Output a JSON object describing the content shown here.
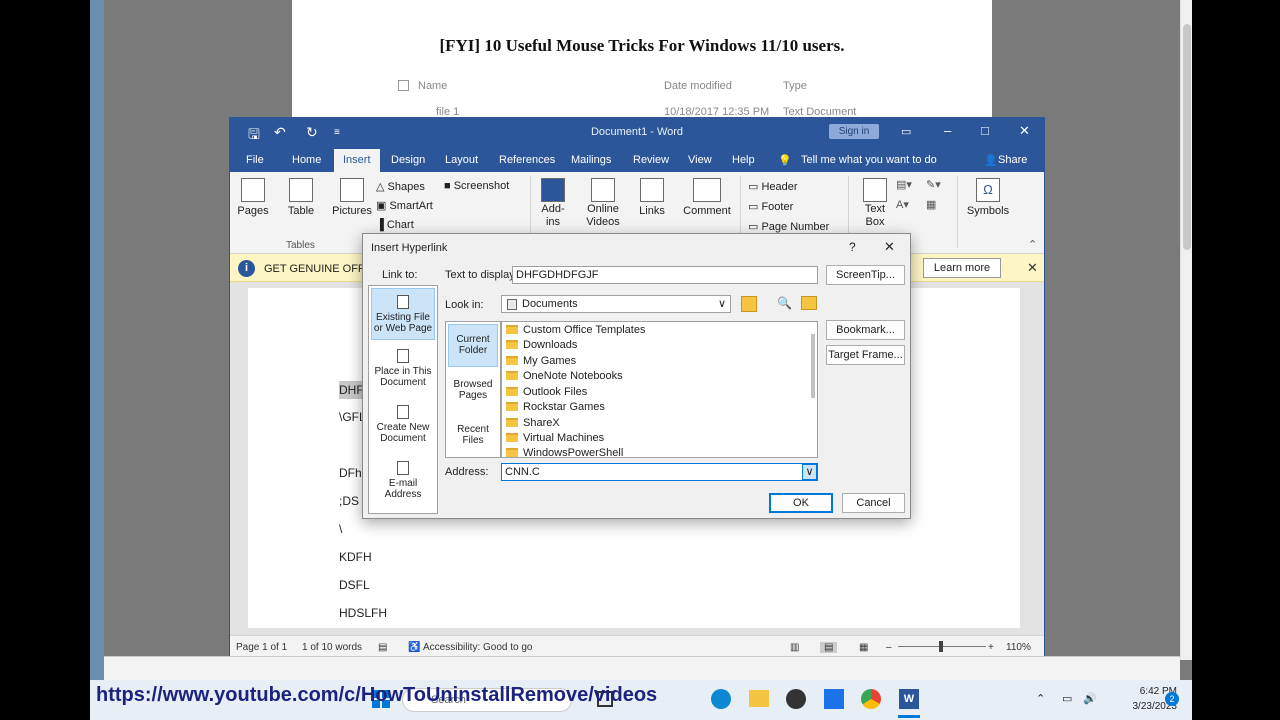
{
  "background_doc": {
    "title": "[FYI] 10 Useful Mouse Tricks For Windows 11/10 users.",
    "columns": [
      "Name",
      "Date modified",
      "Type"
    ],
    "row": {
      "name": "file 1",
      "date": "10/18/2017 12:35 PM",
      "type": "Text Document"
    }
  },
  "word": {
    "title": "Document1  -  Word",
    "sign_in": "Sign in",
    "tabs": [
      "File",
      "Home",
      "Insert",
      "Design",
      "Layout",
      "References",
      "Mailings",
      "Review",
      "View",
      "Help"
    ],
    "tell_me": "Tell me what you want to do",
    "share": "Share",
    "ribbon": {
      "pages": "Pages",
      "table": "Table",
      "tables_group": "Tables",
      "pictures": "Pictures",
      "shapes": "Shapes",
      "smartart": "SmartArt",
      "chart": "Chart",
      "screenshot": "Screenshot",
      "addins_1": "Add-",
      "addins_2": "ins",
      "online_videos_1": "Online",
      "online_videos_2": "Videos",
      "links": "Links",
      "comment": "Comment",
      "header": "Header",
      "footer": "Footer",
      "page_number": "Page Number",
      "text_box_1": "Text",
      "text_box_2": "Box",
      "symbols": "Symbols"
    },
    "genuine_bar": {
      "text": "GET GENUINE OFFICE",
      "learn_more": "Learn more"
    },
    "doc_lines": [
      "DHF",
      "\\GFL",
      "DFh",
      ";DS",
      "\\",
      "KDFH",
      "DSFL",
      "HDSLFH"
    ],
    "status": {
      "page": "Page 1 of 1",
      "words": "1 of 10 words",
      "accessibility": "Accessibility: Good to go",
      "zoom": "110%"
    }
  },
  "dialog": {
    "title": "Insert Hyperlink",
    "help": "?",
    "link_to_label": "Link to:",
    "link_to": [
      {
        "l1": "Existing File",
        "l2": "or Web Page"
      },
      {
        "l1": "Place in This",
        "l2": "Document"
      },
      {
        "l1": "Create New",
        "l2": "Document"
      },
      {
        "l1": "E-mail",
        "l2": "Address"
      }
    ],
    "text_to_display_label": "Text to display:",
    "text_to_display": "DHFGDHDFGJF",
    "screentip": "ScreenTip...",
    "look_in_label": "Look in:",
    "look_in": "Documents",
    "side": [
      {
        "l1": "Current",
        "l2": "Folder"
      },
      {
        "l1": "Browsed",
        "l2": "Pages"
      },
      {
        "l1": "Recent",
        "l2": "Files"
      }
    ],
    "files": [
      "Custom Office Templates",
      "Downloads",
      "My Games",
      "OneNote Notebooks",
      "Outlook Files",
      "Rockstar Games",
      "ShareX",
      "Virtual Machines",
      "WindowsPowerShell"
    ],
    "bookmark": "Bookmark...",
    "target_frame": "Target Frame...",
    "address_label": "Address:",
    "address": "CNN.C",
    "ok": "OK",
    "cancel": "Cancel"
  },
  "taskbar": {
    "url_overlay": "https://www.youtube.com/c/HowToUninstallRemove/videos",
    "search": "Search",
    "time": "6:42 PM",
    "date": "3/23/2023",
    "notifications": "2"
  }
}
